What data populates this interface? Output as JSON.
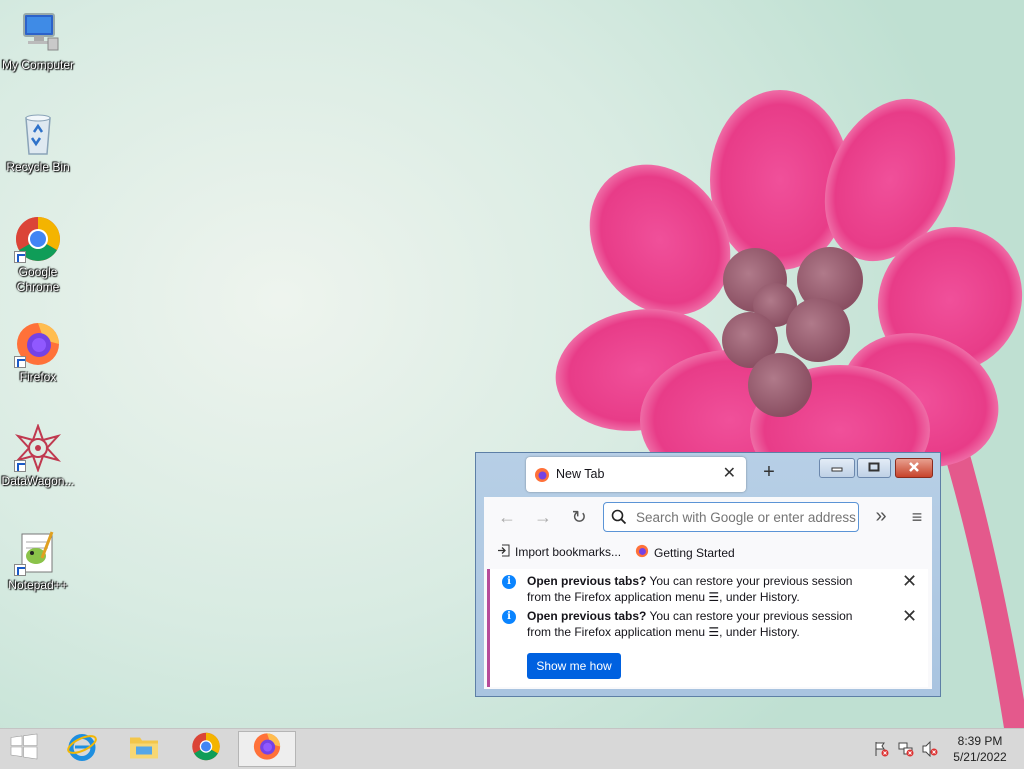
{
  "desktop": {
    "icons": [
      {
        "label": "My Computer",
        "icon": "my-computer-icon"
      },
      {
        "label": "Recycle Bin",
        "icon": "recycle-bin-icon"
      },
      {
        "label": "Google Chrome",
        "icon": "chrome-icon"
      },
      {
        "label": "Firefox",
        "icon": "firefox-icon"
      },
      {
        "label": "DataWagon...",
        "icon": "datawagon-icon"
      },
      {
        "label": "Notepad++",
        "icon": "notepad-plus-plus-icon"
      }
    ]
  },
  "firefox": {
    "tab_title": "New Tab",
    "url_placeholder": "Search with Google or enter address",
    "bookmarks": [
      {
        "label": "Import bookmarks...",
        "icon": "import-icon"
      },
      {
        "label": "Getting Started",
        "icon": "firefox-icon"
      }
    ],
    "notifications": [
      {
        "bold": "Open previous tabs?",
        "text": " You can restore your previous session from the Firefox application menu ☰, under History."
      },
      {
        "bold": "Open previous tabs?",
        "text": " You can restore your previous session from the Firefox application menu ☰, under History."
      }
    ],
    "show_me_how": "Show me how",
    "colors": {
      "accent": "#0061e0",
      "info": "#0a84ff"
    }
  },
  "taskbar": {
    "apps": [
      "start-icon",
      "internet-explorer-icon",
      "file-explorer-icon",
      "chrome-icon",
      "firefox-icon"
    ],
    "active_app": "firefox-icon",
    "tray": [
      "action-center-flag-icon",
      "network-icon",
      "volume-muted-icon"
    ],
    "time": "8:39 PM",
    "date": "5/21/2022"
  }
}
